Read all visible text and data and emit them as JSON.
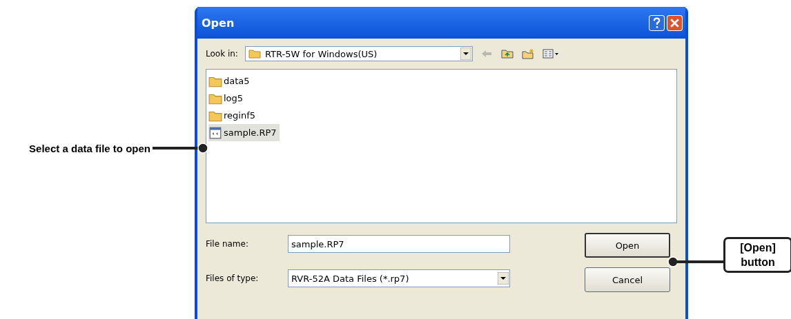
{
  "window": {
    "title": "Open"
  },
  "look_in": {
    "label": "Look in:",
    "value": "RTR-5W for Windows(US)"
  },
  "files": [
    {
      "name": "data5",
      "kind": "folder",
      "selected": false
    },
    {
      "name": "log5",
      "kind": "folder",
      "selected": false
    },
    {
      "name": "reginf5",
      "kind": "folder",
      "selected": false
    },
    {
      "name": "sample.RP7",
      "kind": "file",
      "selected": true
    }
  ],
  "file_name": {
    "label": "File name:",
    "value": "sample.RP7"
  },
  "file_type": {
    "label": "Files of type:",
    "value": "RVR-52A Data Files (*.rp7)"
  },
  "buttons": [
    "Open",
    "Cancel"
  ],
  "callouts": [
    "Select a data file to open",
    "[Open] button"
  ]
}
